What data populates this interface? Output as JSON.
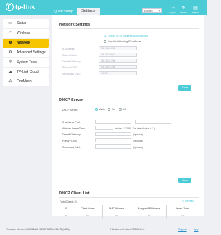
{
  "header": {
    "brand": "tp-link",
    "tabs": [
      {
        "label": "Quick Setup",
        "active": false
      },
      {
        "label": "Settings",
        "active": true
      }
    ],
    "language": "English",
    "actions": [
      {
        "label": "Logout",
        "icon": "logout-icon"
      },
      {
        "label": "Reboot",
        "icon": "reboot-icon"
      },
      {
        "label": "Backup",
        "icon": "backup-icon"
      }
    ]
  },
  "sidebar": {
    "items": [
      {
        "label": "Status",
        "icon": "status-icon",
        "active": false
      },
      {
        "label": "Wireless",
        "icon": "wifi-icon",
        "active": false
      },
      {
        "label": "Network",
        "icon": "globe-icon",
        "active": true
      },
      {
        "label": "Advanced Settings",
        "icon": "gear-icon",
        "active": false
      },
      {
        "label": "System Tools",
        "icon": "tools-icon",
        "active": false
      },
      {
        "label": "TP-Link Cloud",
        "icon": "cloud-icon",
        "active": false
      },
      {
        "label": "OneMesh",
        "icon": "mesh-icon",
        "active": false
      }
    ]
  },
  "network_settings": {
    "title": "Network Settings",
    "radio_auto": "Obtain an IP address automatically",
    "radio_static": "Use the following IP address",
    "fields": [
      {
        "label": "IP Address:",
        "value": "192.168.0.246"
      },
      {
        "label": "Subnet Mask:",
        "value": "255.255.255.0"
      },
      {
        "label": "Default Gateway:",
        "value": "192.168.0.254"
      },
      {
        "label": "Primary DNS:",
        "value": "192.168.0.254"
      },
      {
        "label": "Secondary DNS:",
        "value": "0.0.0.0"
      }
    ],
    "save_label": "Save"
  },
  "dhcp_server": {
    "title": "DHCP Server",
    "server_label": "DHCP Server:",
    "options": [
      "Auto",
      "On",
      "Off"
    ],
    "selected": "Auto",
    "pool_label": "IP Address Pool:",
    "pool_sep": "-",
    "lease_label": "Address Lease Time:",
    "lease_note": "minutes. (1-2880. The default value is 1.)",
    "gateway_label": "Default Gateway:",
    "primary_label": "Primary DNS:",
    "secondary_label": "Secondary DNS:",
    "optional": "(Optional)",
    "save_label": "Save"
  },
  "dhcp_client_list": {
    "title": "DHCP Client List",
    "total_label": "Total Clients: 0",
    "refresh_label": "Refresh",
    "columns": [
      "ID",
      "Client Name",
      "MAC Address",
      "Assigned IP Address",
      "Lease Time"
    ],
    "rows": [
      [
        "---",
        "---",
        "---",
        "---",
        "---"
      ]
    ]
  },
  "footer": {
    "firmware": "Firmware Version: 1.0.0 Build 20210706 Rel. 56479(5483)",
    "hardware": "Hardware Version: RE650 v2.0",
    "support": "Support",
    "app": "App"
  },
  "colors": {
    "accent": "#4acbd6",
    "active_nav": "#f7c500",
    "background": "#eef0f3"
  }
}
